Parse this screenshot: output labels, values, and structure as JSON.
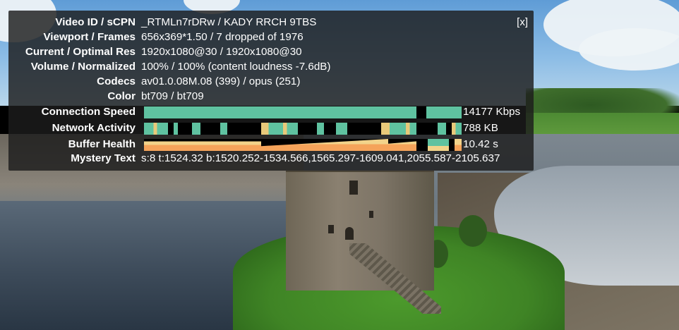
{
  "stats": {
    "close_label": "[x]",
    "rows": {
      "video_id": {
        "label": "Video ID / sCPN",
        "value": "_RTMLn7rDRw / KADY RRCH 9TBS"
      },
      "viewport": {
        "label": "Viewport / Frames",
        "value": "656x369*1.50 / 7 dropped of 1976"
      },
      "resolution": {
        "label": "Current / Optimal Res",
        "value": "1920x1080@30 / 1920x1080@30"
      },
      "volume": {
        "label": "Volume / Normalized",
        "value": "100% / 100% (content loudness -7.6dB)"
      },
      "codecs": {
        "label": "Codecs",
        "value": "av01.0.08M.08 (399) / opus (251)"
      },
      "color": {
        "label": "Color",
        "value": "bt709 / bt709"
      },
      "connection_speed": {
        "label": "Connection Speed",
        "value": "14177 Kbps"
      },
      "network_activity": {
        "label": "Network Activity",
        "value": "788 KB"
      },
      "buffer_health": {
        "label": "Buffer Health",
        "value": "10.42 s"
      },
      "mystery_text": {
        "label": "Mystery Text",
        "value": "s:8 t:1524.32 b:1520.252-1534.566,1565.297-1609.041,2055.587-2105.637"
      }
    },
    "colors": {
      "connection_bar": "#5fc2a0",
      "network_bar": "#5fc2a0",
      "network_bar_alt": "#e8c97a",
      "buffer_fill": "#f2d38a",
      "buffer_low": "#f5a35a",
      "graph_gap": "#000000",
      "panel_bg": "rgba(28,28,28,0.82)"
    }
  }
}
